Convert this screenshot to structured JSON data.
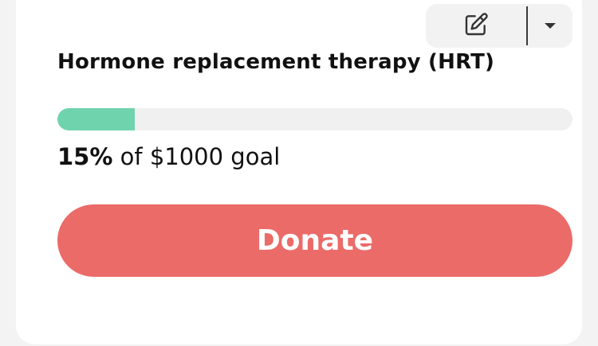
{
  "card": {
    "title": "Hormone replacement therapy (HRT)",
    "progress": {
      "percent_label": "15%",
      "fraction": 0.15,
      "fill_color": "#6fd3ad",
      "track_color": "#f0f0f0"
    },
    "goal_text_middle": " of ",
    "goal_amount": "$1000",
    "goal_suffix": " goal",
    "donate_label": "Donate",
    "donate_color": "#eb6b69"
  },
  "actions": {
    "edit_icon": "edit-icon",
    "dropdown_icon": "caret-down-icon"
  }
}
